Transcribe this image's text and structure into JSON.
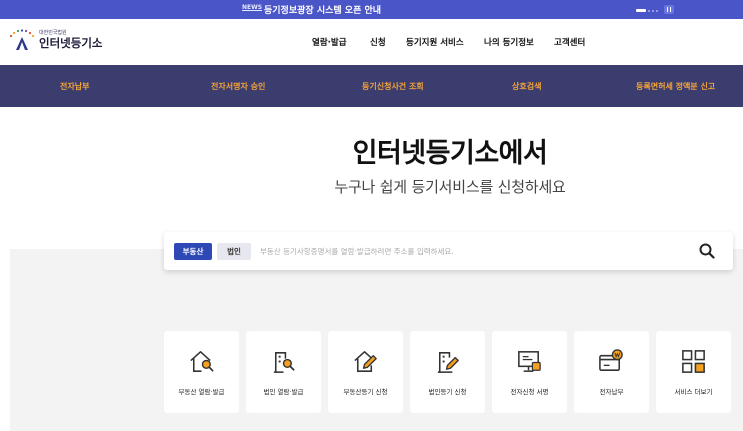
{
  "news": {
    "label": "NEWS",
    "text": "등기정보광장 시스템 오픈 안내"
  },
  "logo": {
    "subtitle": "대한민국법원",
    "title": "인터넷등기소"
  },
  "main_menu": [
    "열람·발급",
    "신청",
    "등기지원 서비스",
    "나의 등기정보",
    "고객센터"
  ],
  "quick_nav": [
    "전자납부",
    "전자서명자 승인",
    "등기신청사건 조회",
    "상호검색",
    "등록면허세 정액분 신고"
  ],
  "hero": {
    "title": "인터넷등기소에서",
    "subtitle": "누구나 쉽게 등기서비스를 신청하세요"
  },
  "search": {
    "tabs": [
      "부동산",
      "법인"
    ],
    "selected_tab": "부동산",
    "placeholder": "부동산 등기사항증명서를 열람·발급하려면 주소를 입력하세요.",
    "value": ""
  },
  "services": [
    {
      "label": "부동산 열람·발급",
      "icon": "house-search-icon"
    },
    {
      "label": "법인 열람·발급",
      "icon": "building-search-icon"
    },
    {
      "label": "부동산등기 신청",
      "icon": "house-edit-icon"
    },
    {
      "label": "법인등기 신청",
      "icon": "building-edit-icon"
    },
    {
      "label": "전자신청 서명",
      "icon": "monitor-sign-icon"
    },
    {
      "label": "전자납부",
      "icon": "card-payment-icon"
    },
    {
      "label": "서비스 더보기",
      "icon": "grid-more-icon"
    }
  ],
  "colors": {
    "news_bar": "#4a55c8",
    "nav_band": "#3a3d6d",
    "nav_text": "#f4a33c",
    "accent_blue": "#2e49b6",
    "icon_orange": "#f4a020",
    "icon_stroke": "#333333"
  }
}
